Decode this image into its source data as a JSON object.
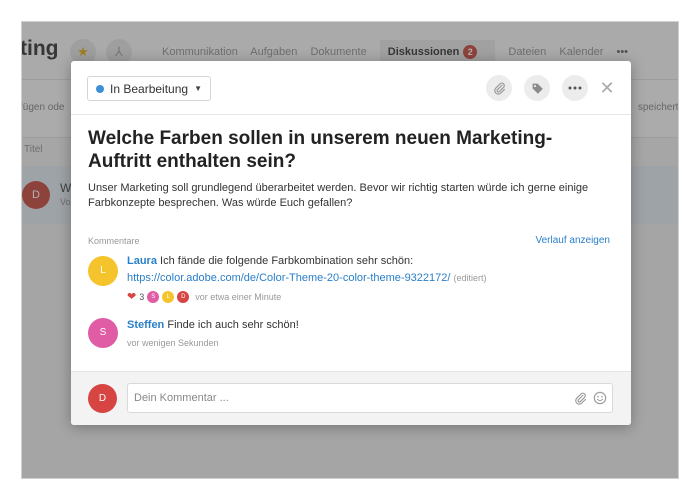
{
  "background": {
    "title": "ting",
    "tabs": [
      "Kommunikation",
      "Aufgaben",
      "Dokumente",
      "Diskussionen",
      "Dateien",
      "Kalender"
    ],
    "active_tab_badge": "2",
    "more": "•••",
    "toolbar_left": "fügen ode",
    "toolbar_right": "speicherte",
    "column_title": "Titel",
    "row_avatar": "D",
    "row_title": "W",
    "row_sub": "Vo"
  },
  "modal": {
    "status": {
      "label": "In Bearbeitung",
      "color": "#3d8fd6"
    },
    "icons": [
      "paperclip-icon",
      "tag-icon",
      "more-icon",
      "close-icon"
    ],
    "title": "Welche Farben sollen in unserem neuen Marketing-Auftritt enthalten sein?",
    "description": "Unser Marketing soll grundlegend überarbeitet werden. Bevor wir richtig starten würde ich gerne einige Farbkonzepte besprechen. Was würde Euch gefallen?",
    "comments_label": "Kommentare",
    "history_link": "Verlauf anzeigen",
    "comments": [
      {
        "avatar": "L",
        "avatar_color": "#f5c42c",
        "author": "Laura",
        "text": "Ich fände die folgende Farbkombination sehr schön:",
        "link": "https://color.adobe.com/de/Color-Theme-20-color-theme-9322172/",
        "edited": "(editiert)",
        "likes": "3",
        "reactors": [
          {
            "initial": "S",
            "color": "#e05ca4"
          },
          {
            "initial": "L",
            "color": "#f5c42c"
          },
          {
            "initial": "D",
            "color": "#d64541"
          }
        ],
        "time": "vor etwa einer Minute"
      },
      {
        "avatar": "S",
        "avatar_color": "#e05ca4",
        "author": "Steffen",
        "text": "Finde ich auch sehr schön!",
        "time": "vor wenigen Sekunden"
      }
    ],
    "footer": {
      "avatar": "D",
      "placeholder": "Dein Kommentar ..."
    }
  }
}
